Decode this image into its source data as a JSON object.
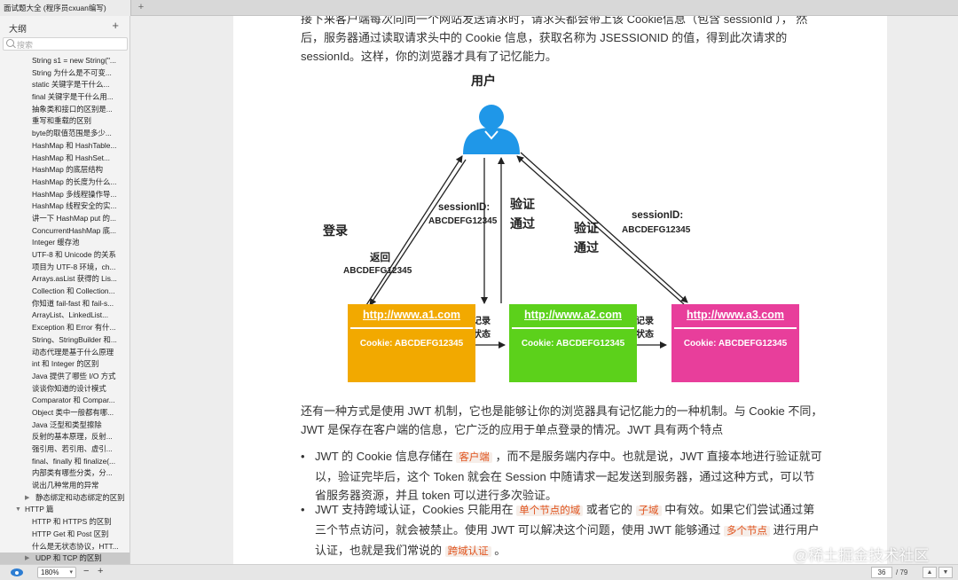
{
  "tab": {
    "title": "面试题大全 (程序员cxuan编写)",
    "add": "+"
  },
  "sidebar": {
    "title": "大纲",
    "add": "+",
    "search_placeholder": "搜索",
    "items": [
      {
        "label": "String s1 = new String(\"...",
        "level": 2
      },
      {
        "label": "String 为什么是不可变...",
        "level": 2
      },
      {
        "label": "static 关键字是干什么...",
        "level": 2
      },
      {
        "label": "final 关键字是干什么用...",
        "level": 2
      },
      {
        "label": "抽象类和接口的区别是...",
        "level": 2
      },
      {
        "label": "重写和重载的区别",
        "level": 2
      },
      {
        "label": "byte的取值范围是多少...",
        "level": 2
      },
      {
        "label": "HashMap 和 HashTable...",
        "level": 2
      },
      {
        "label": "HashMap 和 HashSet...",
        "level": 2
      },
      {
        "label": "HashMap 的底层结构",
        "level": 2
      },
      {
        "label": "HashMap 的长度为什么...",
        "level": 2
      },
      {
        "label": "HashMap 多线程操作导...",
        "level": 2
      },
      {
        "label": "HashMap 线程安全的实...",
        "level": 2
      },
      {
        "label": "讲一下 HashMap put 的...",
        "level": 2
      },
      {
        "label": "ConcurrentHashMap 底...",
        "level": 2
      },
      {
        "label": "Integer 缓存池",
        "level": 2
      },
      {
        "label": "UTF-8 和 Unicode 的关系",
        "level": 2
      },
      {
        "label": "项目为 UTF-8 环境，ch...",
        "level": 2
      },
      {
        "label": "Arrays.asList 获得的 Lis...",
        "level": 2
      },
      {
        "label": "Collection 和 Collection...",
        "level": 2
      },
      {
        "label": "你知道 fail-fast 和 fail-s...",
        "level": 2
      },
      {
        "label": "ArrayList、LinkedList...",
        "level": 2
      },
      {
        "label": "Exception 和 Error 有什...",
        "level": 2
      },
      {
        "label": "String、StringBuilder 和...",
        "level": 2
      },
      {
        "label": "动态代理是基于什么原理",
        "level": 2
      },
      {
        "label": "int 和 Integer 的区别",
        "level": 2
      },
      {
        "label": "Java 提供了哪些 I/O 方式",
        "level": 2
      },
      {
        "label": "谈谈你知道的设计模式",
        "level": 2
      },
      {
        "label": "Comparator 和 Compar...",
        "level": 2
      },
      {
        "label": "Object 类中一般都有哪...",
        "level": 2
      },
      {
        "label": "Java 泛型和类型擦除",
        "level": 2
      },
      {
        "label": "反射的基本原理，反射...",
        "level": 2
      },
      {
        "label": "强引用、若引用、虚引...",
        "level": 2
      },
      {
        "label": "final、finally 和 finalize(...",
        "level": 2
      },
      {
        "label": "内部类有哪些分类，分...",
        "level": 2
      },
      {
        "label": "说出几种常用的异常",
        "level": 2
      },
      {
        "label": "静态绑定和动态绑定的区别",
        "level": 2,
        "collapsed": true
      },
      {
        "label": "HTTP 篇",
        "level": 1,
        "expanded": true
      },
      {
        "label": "HTTP 和 HTTPS 的区别",
        "level": 2
      },
      {
        "label": "HTTP Get 和 Post 区别",
        "level": 2
      },
      {
        "label": "什么是无状态协议，HTT...",
        "level": 2
      },
      {
        "label": "UDP 和 TCP 的区别",
        "level": 2,
        "collapsed": true,
        "selected": true
      }
    ]
  },
  "document": {
    "para1": "接下来客户端每次向同一个网站发送请求时，请求头都会带上该 Cookie信息（包含 sessionId ）， 然后，服务器通过读取请求头中的 Cookie 信息，获取名称为 JSESSIONID 的值，得到此次请求的 sessionId。这样，你的浏览器才具有了记忆能力。",
    "diagram": {
      "user_label": "用户",
      "login": "登录",
      "return_label": "返回",
      "return_value": "ABCDEFG12345",
      "sid_mid_label": "sessionID:",
      "sid_mid_value": "ABCDEFG12345",
      "verify_mid_1": "验证",
      "verify_mid_2": "通过",
      "verify_right_1": "验证",
      "verify_right_2": "通过",
      "sid_right_label": "sessionID:",
      "sid_right_value": "ABCDEFG12345",
      "record_1a": "记录",
      "record_1b": "状态",
      "record_2a": "记录",
      "record_2b": "状态",
      "boxes": [
        {
          "url": "http://www.a1.com",
          "cookie": "Cookie:   ABCDEFG12345",
          "color": "#f2a900"
        },
        {
          "url": "http://www.a2.com",
          "cookie": "Cookie:   ABCDEFG12345",
          "color": "#5cd11b"
        },
        {
          "url": "http://www.a3.com",
          "cookie": "Cookie:   ABCDEFG12345",
          "color": "#e83e9b"
        }
      ],
      "user_color": "#1f97e8"
    },
    "para2": "还有一种方式是使用 JWT 机制，它也是能够让你的浏览器具有记忆能力的一种机制。与 Cookie 不同，JWT 是保存在客户端的信息，它广泛的应用于单点登录的情况。JWT 具有两个特点",
    "bullet1": {
      "a": "JWT 的 Cookie 信息存储在",
      "tag1": "客户端",
      "b": "，而不是服务端内存中。也就是说，JWT 直接本地进行验证就可以，验证完毕后，这个 Token 就会在 Session 中随请求一起发送到服务器，通过这种方式，可以节省服务器资源，并且 token 可以进行多次验证。"
    },
    "bullet2": {
      "a": "JWT 支持跨域认证，Cookies 只能用在",
      "tag1": "单个节点的域",
      "b": "或者它的",
      "tag2": "子域",
      "c": "中有效。如果它们尝试通过第三个节点访问，就会被禁止。使用 JWT 可以解决这个问题，使用 JWT 能够通过",
      "tag3": "多个节点",
      "d": "进行用户认证，也就是我们常说的",
      "tag4": "跨域认证",
      "e": "。"
    }
  },
  "statusbar": {
    "zoom": "180%",
    "zoom_out": "−",
    "zoom_in": "+",
    "page": "36",
    "total": "/ 79",
    "prev": "▲",
    "next": "▼"
  },
  "watermark": "@稀土掘金技术社区",
  "icons": {
    "search": "search-icon",
    "eye": "eye-icon",
    "user": "user-icon",
    "chevron": "chevron-down-icon",
    "triangle_right": "triangle-right-icon",
    "triangle_down": "triangle-down-icon"
  }
}
